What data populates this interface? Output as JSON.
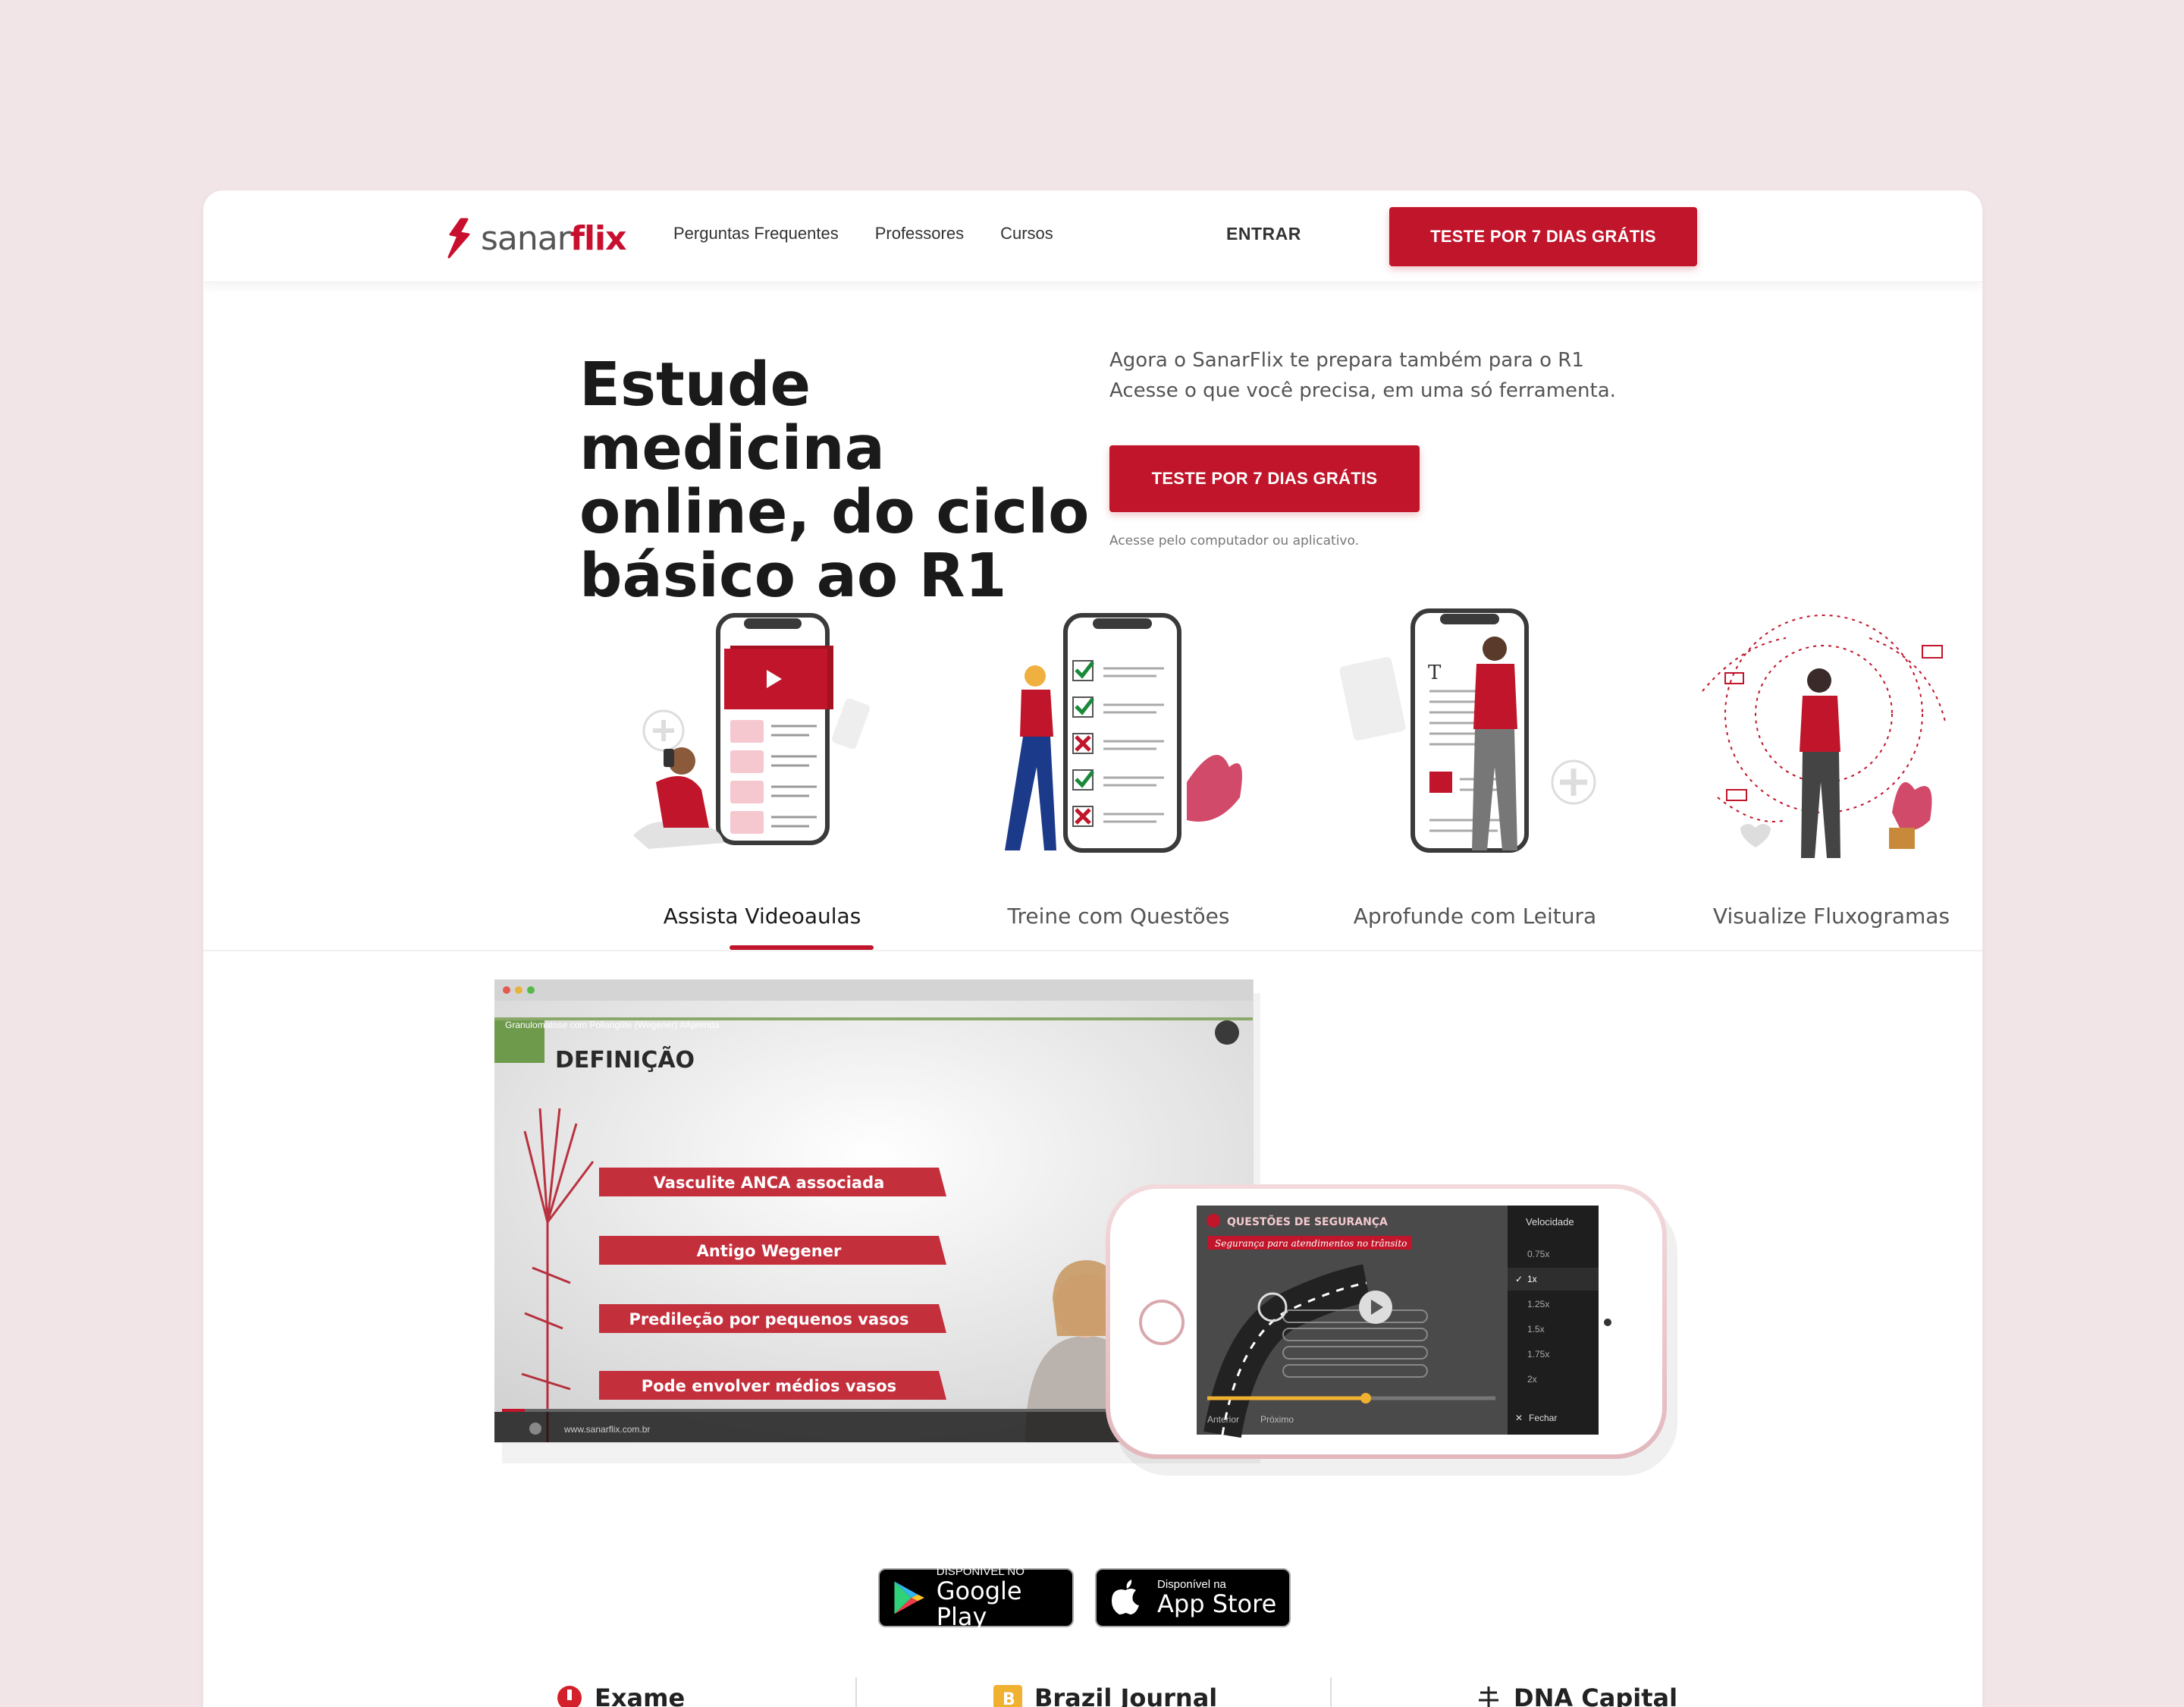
{
  "nav": {
    "logo_left": "sanar",
    "logo_right": "flix",
    "links": [
      "Perguntas Frequentes",
      "Professores",
      "Cursos"
    ],
    "login": "ENTRAR",
    "cta": "TESTE POR 7 DIAS GRÁTIS"
  },
  "hero": {
    "title_lines": [
      "Estude medicina",
      "online, do ciclo",
      "básico ao R1"
    ],
    "subtitle_lines": [
      "Agora o SanarFlix te prepara também para o R1",
      "Acesse o que você precisa, em uma só ferramenta."
    ],
    "cta": "TESTE POR 7 DIAS GRÁTIS",
    "note": "Acesse pelo computador ou aplicativo."
  },
  "features": [
    {
      "label": "Assista Videoaulas",
      "active": true
    },
    {
      "label": "Treine com Questões",
      "active": false
    },
    {
      "label": "Aprofunde com Leitura",
      "active": false
    },
    {
      "label": "Visualize Fluxogramas",
      "active": false
    }
  ],
  "video": {
    "header": "Granulomatose com Poliangiíte (Wegener) #Aprenda",
    "slide_title": "DEFINIÇÃO",
    "bullets": [
      "Vasculite ANCA associada",
      "Antigo Wegener",
      "Predileção por pequenos vasos",
      "Pode envolver médios vasos"
    ],
    "url": "www.sanarflix.com.br"
  },
  "phone": {
    "title": "QUESTÕES DE SEGURANÇA",
    "subtitle": "Segurança para atendimentos no trânsito",
    "speed_title": "Velocidade",
    "speeds": [
      "0.75x",
      "1x",
      "1.25x",
      "1.5x",
      "1.75x",
      "2x"
    ],
    "selected_speed": "1x",
    "close": "Fechar",
    "prev": "Anterior",
    "next": "Próximo",
    "progress": 0.55
  },
  "stores": {
    "google_small": "DISPONÍVEL NO",
    "google_big": "Google Play",
    "apple_small": "Disponível na",
    "apple_big": "App Store"
  },
  "press": [
    "Exame",
    "Brazil Journal",
    "DNA Capital"
  ],
  "colors": {
    "brand": "#c0152a",
    "background": "#f1e5e7"
  }
}
